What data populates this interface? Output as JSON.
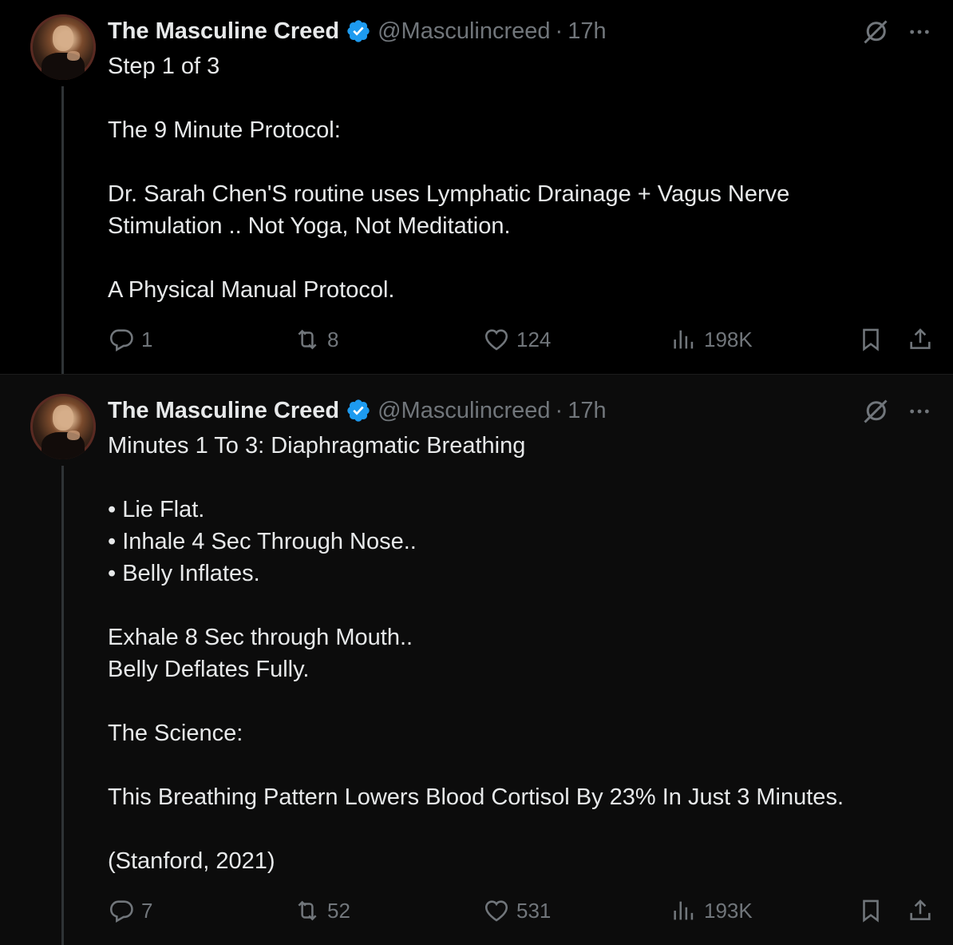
{
  "colors": {
    "background": "#000000",
    "text": "#e7e9ea",
    "muted": "#71767b",
    "verified": "#1d9bf0"
  },
  "tweets": [
    {
      "author_name": "The Masculine Creed",
      "handle": "@Masculincreed",
      "separator": "·",
      "time": "17h",
      "lines": [
        "Step 1 of 3",
        "",
        "The 9 Minute Protocol:",
        "",
        "Dr. Sarah Chen'S routine uses Lymphatic Drainage + Vagus Nerve",
        "Stimulation .. Not Yoga, Not Meditation.",
        "",
        "A Physical Manual Protocol."
      ],
      "replies": "1",
      "reposts": "8",
      "likes": "124",
      "views": "198K"
    },
    {
      "author_name": "The Masculine Creed",
      "handle": "@Masculincreed",
      "separator": "·",
      "time": "17h",
      "lines": [
        "Minutes 1 To 3: Diaphragmatic Breathing",
        "",
        "• Lie Flat.",
        "• Inhale 4 Sec Through Nose..",
        "• Belly Inflates.",
        "",
        "Exhale 8 Sec through Mouth..",
        "Belly Deflates Fully.",
        "",
        "The Science:",
        "",
        "This Breathing Pattern Lowers Blood Cortisol By 23% In Just 3 Minutes.",
        "",
        "(Stanford, 2021)"
      ],
      "replies": "7",
      "reposts": "52",
      "likes": "531",
      "views": "193K"
    }
  ],
  "icons": [
    "verified-badge-icon",
    "grok-icon",
    "more-icon",
    "reply-icon",
    "repost-icon",
    "like-icon",
    "views-icon",
    "bookmark-icon",
    "share-icon"
  ]
}
